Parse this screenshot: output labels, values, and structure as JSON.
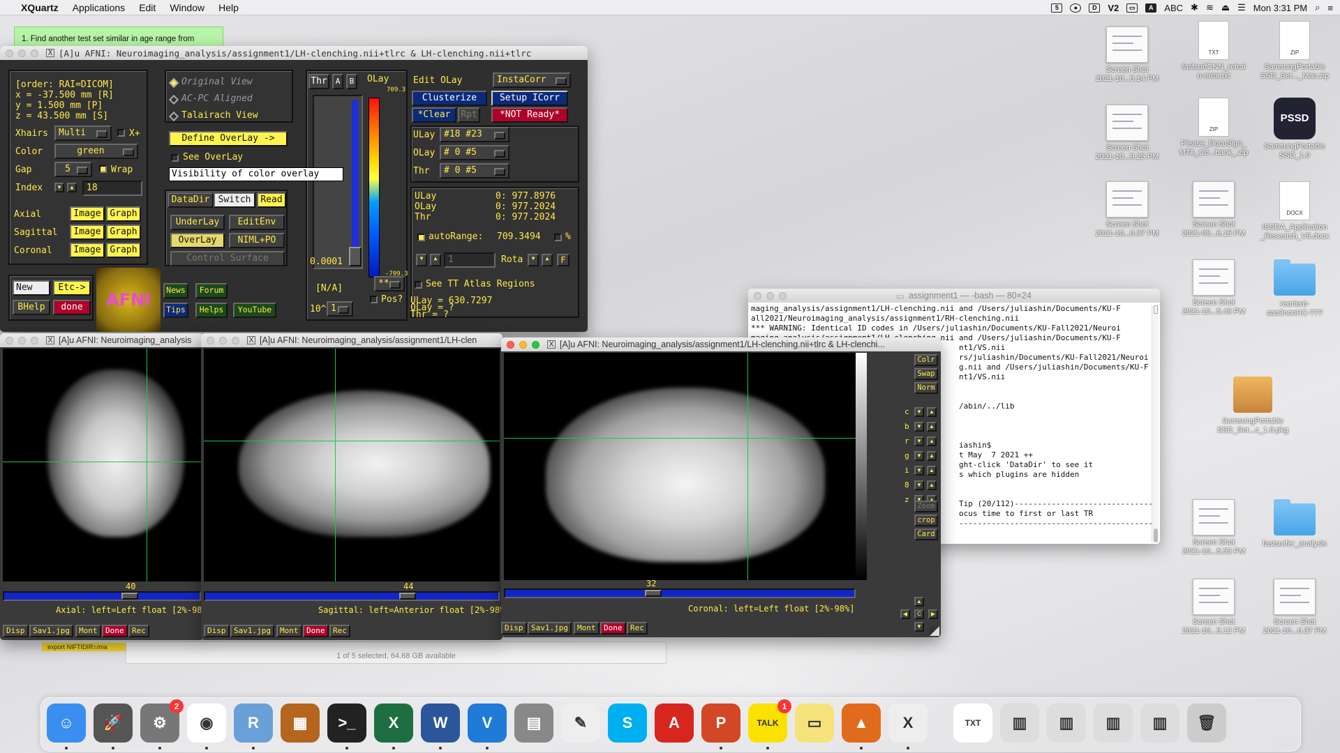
{
  "menubar": {
    "app": "XQuartz",
    "items": [
      "Applications",
      "Edit",
      "Window",
      "Help"
    ],
    "input_source": "ABC",
    "clock": "Mon 3:31 PM"
  },
  "sticky": {
    "text": "1. Find another test set similar in age range from"
  },
  "afni_main": {
    "title": "[A]u AFNI: Neuroimaging_analysis/assignment1/LH-clenching.nii+tlrc & LH-clenching.nii+tlrc",
    "coords": {
      "order": "[order: RAI=DICOM]",
      "x": "x =  -37.500 mm [R]",
      "y": "y =    1.500 mm [P]",
      "z": "z =   43.500 mm [S]"
    },
    "xhairs_label": "Xhairs",
    "xhairs_value": "Multi",
    "xplus": "X+",
    "color_label": "Color",
    "color_value": "green",
    "gap_label": "Gap",
    "gap_value": "5",
    "wrap": "Wrap",
    "index_label": "Index",
    "index_value": "18",
    "views": [
      {
        "name": "Axial",
        "image": "Image",
        "graph": "Graph"
      },
      {
        "name": "Sagittal",
        "image": "Image",
        "graph": "Graph"
      },
      {
        "name": "Coronal",
        "image": "Image",
        "graph": "Graph"
      }
    ],
    "new": "New",
    "etc": "Etc->",
    "bhelp": "BHelp",
    "done": "done",
    "logo": "AFNI",
    "news": "News",
    "forum": "Forum",
    "tips": "Tips",
    "helps": "Helps",
    "youtube": "YouTube",
    "view_modes": [
      "Original View",
      "AC-PC Aligned",
      "Talairach View"
    ],
    "define_overlay": "Define OverLay ->",
    "see_overlay": "See OverLay",
    "tooltip": "Visibility of color overlay",
    "datadir": "DataDir",
    "switch": "Switch",
    "read": "Read",
    "underlay": "UnderLay",
    "editenv": "EditEnv",
    "overlay": "OverLay",
    "niml": "NIML+PO",
    "control_surface": "Control Surface",
    "thr": "Thr",
    "a": "A",
    "b": "B",
    "olay": "OLay",
    "olay_max": "709.3",
    "olay_min": "-709.3",
    "thr_value": "0.0001",
    "na": "[N/A]",
    "pow": "10^",
    "pow_val": "1",
    "star": "**",
    "pos": "Pos?",
    "edit_olay": "Edit OLay",
    "instacorr": "InstaCorr",
    "clusterize": "Clusterize",
    "setup_icorr": "Setup ICorr",
    "clear": "*Clear",
    "rpt": "Rpt",
    "not_ready": "*NOT Ready*",
    "ulay_lbl": "ULay",
    "ulay_val": "#18 #23",
    "olay_lbl": "OLay",
    "olay_val": "# 0 #5",
    "thr_lbl": "Thr",
    "thr_val": "# 0 #5",
    "info": [
      {
        "k": "ULay",
        "v": "0: 977.8976"
      },
      {
        "k": "OLay",
        "v": "0: 977.2024"
      },
      {
        "k": "Thr",
        "v": "0: 977.2024"
      }
    ],
    "autorange_label": "autoRange:",
    "autorange_value": "709.3494",
    "pct": "%",
    "rota": "Rota",
    "f": "F",
    "spin_val": "1",
    "see_tt": "See TT Atlas Regions",
    "ulay_readout": "ULay = 630.7297",
    "olay_readout": "OLay = ?",
    "thr_readout": "Thr  = ?"
  },
  "axial": {
    "title": "[A]u AFNI: Neuroimaging_analysis",
    "slice": "40",
    "caption": "Axial: left=Left float [2%-98%",
    "buttons": [
      "Disp",
      "Sav1.jpg",
      "Mont",
      "Done",
      "Rec"
    ]
  },
  "sagittal": {
    "title": "[A]u AFNI: Neuroimaging_analysis/assignment1/LH-clen",
    "slice": "44",
    "caption": "Sagittal: left=Anterior float [2%-98%",
    "buttons": [
      "Disp",
      "Sav1.jpg",
      "Mont",
      "Done",
      "Rec"
    ]
  },
  "coronal": {
    "title": "[A]u AFNI: Neuroimaging_analysis/assignment1/LH-clenching.nii+tlrc & LH-clenchi...",
    "slice": "32",
    "caption": "Coronal: left=Left float [2%-98%]",
    "buttons": [
      "Disp",
      "Sav1.jpg",
      "Mont",
      "Done",
      "Rec"
    ],
    "side": [
      "Colr",
      "Swap",
      "Norm"
    ],
    "side2": [
      "Zoom",
      "crop",
      "Card"
    ],
    "adjust": [
      "c",
      "b",
      "r",
      "g",
      "i",
      "8",
      "z"
    ]
  },
  "finder_status": "1 of 5 selected, 64.68 GB available",
  "finder_row": "export NIFTIDIR=/ma",
  "terminal": {
    "title": "assignment1 — -bash — 80×24",
    "lines": [
      "maging_analysis/assignment1/LH-clenching.nii and /Users/juliashin/Documents/KU-F",
      "all2021/Neuroimaging_analysis/assignment1/RH-clenching.nii",
      "*** WARNING: Identical ID codes in /Users/juliashin/Documents/KU-Fall2021/Neuroi",
      "maging_analysis/assignment1/LH-clenching.nii and /Users/juliashin/Documents/KU-F",
      "                                             nt1/VS.nii",
      "                                             rs/juliashin/Documents/KU-Fall2021/Neuroi",
      "                                             g.nii and /Users/juliashin/Documents/KU-F",
      "                                             nt1/VS.nii",
      "",
      "",
      "                                             /abin/../lib",
      "",
      "",
      "",
      "                                             iashin$",
      "                                             t May  7 2021 ++",
      "                                             ght-click 'DataDir' to see it",
      "                                             s which plugins are hidden",
      "",
      "",
      "                                             Tip (20/112)------------------------------",
      "                                             ocus time to first or last TR",
      "                                             ------------------------------------------"
    ]
  },
  "desktop": [
    {
      "label": "Screen Shot\n2021-10...3.14 PM",
      "kind": "shot"
    },
    {
      "label": "fastsurfCNN_retrai\nn-error.txt",
      "kind": "txt",
      "tag": "TXT"
    },
    {
      "label": "SamsungPortable\nSSD_Set..._Mac.zip",
      "kind": "zip",
      "tag": "ZIP"
    },
    {
      "label": "Screen Shot\n2021-10...9.25 PM",
      "kind": "shot"
    },
    {
      "label": "Please_DocuSign_\nMTA_Co...bank_.zip",
      "kind": "zip",
      "tag": "ZIP"
    },
    {
      "label": "SamsungPortable\nSSD_1.0",
      "kind": "pssd",
      "tag": "PSSD"
    },
    {
      "label": "Screen Shot\n2021-10...0.37 PM",
      "kind": "shot"
    },
    {
      "label": "Screen Shot\n2021-08...6.15 PM",
      "kind": "shot"
    },
    {
      "label": "ISSDA_Application\n_Research_V5.docx",
      "kind": "doc",
      "tag": "DOCX"
    },
    {
      "label": "Screen Shot\n2021-10...5.46 PM",
      "kind": "shot"
    },
    {
      "label": "reorient-\noas3nonHC-???",
      "kind": "folder"
    },
    {
      "label": "SamsungPortable\nSSD_Set...c_1.0.pkg",
      "kind": "pkg"
    },
    {
      "label": "Screen Shot\n2021-10...5.53 PM",
      "kind": "shot"
    },
    {
      "label": "fastsurfer_analysis",
      "kind": "folder"
    },
    {
      "label": "Screen Shot\n2021-10...3.12 PM",
      "kind": "shot"
    },
    {
      "label": "Screen Shot\n2021-10...0.37 PM",
      "kind": "shot"
    }
  ],
  "dock": [
    {
      "name": "Finder",
      "color": "#3a8ef0",
      "glyph": "☺"
    },
    {
      "name": "Launchpad",
      "color": "#555",
      "glyph": "🚀"
    },
    {
      "name": "System Preferences",
      "color": "#777",
      "glyph": "⚙",
      "badge": "2"
    },
    {
      "name": "Chrome",
      "color": "#fff",
      "glyph": "◉"
    },
    {
      "name": "R",
      "color": "#6aa0d8",
      "glyph": "R"
    },
    {
      "name": "Calculator",
      "color": "#b5651d",
      "glyph": "▦"
    },
    {
      "name": "Terminal",
      "color": "#222",
      "glyph": ">_"
    },
    {
      "name": "Excel",
      "color": "#1d6f42",
      "glyph": "X"
    },
    {
      "name": "Word",
      "color": "#2b579a",
      "glyph": "W"
    },
    {
      "name": "VS Code",
      "color": "#1f7ad8",
      "glyph": "V"
    },
    {
      "name": "Preview",
      "color": "#888",
      "glyph": "▤"
    },
    {
      "name": "TextEdit",
      "color": "#eee",
      "glyph": "✎"
    },
    {
      "name": "Skype",
      "color": "#00aff0",
      "glyph": "S"
    },
    {
      "name": "Acrobat",
      "color": "#d7261d",
      "glyph": "A"
    },
    {
      "name": "PowerPoint",
      "color": "#d24726",
      "glyph": "P"
    },
    {
      "name": "KakaoTalk",
      "color": "#fae100",
      "glyph": "TALK",
      "badge": "1"
    },
    {
      "name": "Stickies",
      "color": "#f5e27a",
      "glyph": "▭"
    },
    {
      "name": "MATLAB",
      "color": "#e16b1a",
      "glyph": "▲"
    },
    {
      "name": "XQuartz",
      "color": "#eee",
      "glyph": "X"
    },
    {
      "name": "txt",
      "color": "#fff",
      "glyph": "TXT"
    },
    {
      "name": "Downloads",
      "color": "#ddd",
      "glyph": "▥"
    },
    {
      "name": "Documents",
      "color": "#ddd",
      "glyph": "▥"
    },
    {
      "name": "Recent",
      "color": "#ddd",
      "glyph": "▥"
    },
    {
      "name": "Screens",
      "color": "#ddd",
      "glyph": "▥"
    },
    {
      "name": "Trash",
      "color": "#ccc",
      "glyph": "🗑"
    }
  ]
}
